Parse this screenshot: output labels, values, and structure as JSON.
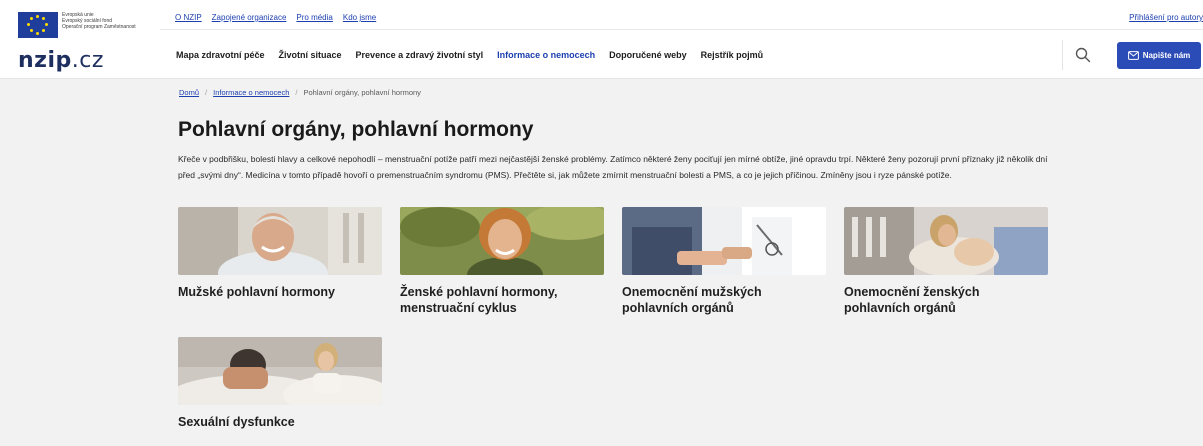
{
  "header": {
    "eu_lines": [
      "Evropská unie",
      "Evropský sociální fond",
      "Operační program Zaměstnanost"
    ],
    "brand_main": "nzip",
    "brand_suffix": ".cz",
    "top_links": [
      "O NZIP",
      "Zapojené organizace",
      "Pro média",
      "Kdo jsme"
    ],
    "login_link": "Přihlášení pro autory",
    "nav": [
      "Mapa zdravotní péče",
      "Životní situace",
      "Prevence a zdravý životní styl",
      "Informace o nemocech",
      "Doporučené weby",
      "Rejstřík pojmů"
    ],
    "nav_active_index": 3,
    "contact_button": "Napište nám"
  },
  "breadcrumb": [
    "Domů",
    "Informace o nemocech",
    "Pohlavní orgány, pohlavní hormony"
  ],
  "page": {
    "title": "Pohlavní orgány, pohlavní hormony",
    "intro": "Křeče v podbřišku, bolesti hlavy a celkové nepohodlí – menstruační potíže patří mezi nejčastější ženské problémy. Zatímco některé ženy pociťují jen mírné obtíže, jiné opravdu trpí. Některé ženy pozorují první příznaky již několik dní před „svými dny“. Medicína v tomto případě hovoří o premenstruačním syndromu (PMS). Přečtěte si, jak můžete zmírnit menstruační bolesti a PMS, a co je jejich příčinou. Zmíněny jsou i ryze pánské potíže."
  },
  "cards": [
    {
      "title": "Mužské pohlavní hormony"
    },
    {
      "title": "Ženské pohlavní hormony, menstruační cyklus"
    },
    {
      "title": "Onemocnění mužských pohlavních orgánů"
    },
    {
      "title": "Onemocnění ženských pohlavních orgánů"
    },
    {
      "title": "Sexuální dysfunkce"
    }
  ],
  "colors": {
    "accent": "#2b4bb7",
    "link": "#1c3fb0",
    "background": "#f2f2f2"
  }
}
